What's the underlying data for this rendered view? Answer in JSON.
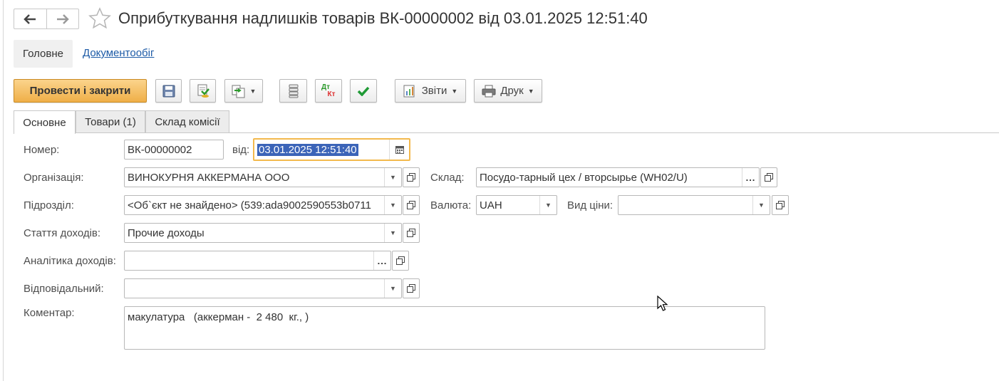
{
  "window": {
    "title": "Оприбуткування надлишків товарів ВК-00000002 від 03.01.2025 12:51:40"
  },
  "sections": {
    "main": "Головне",
    "docflow": "Документообіг"
  },
  "toolbar": {
    "post_and_close": "Провести і закрити",
    "reports": "Звіти",
    "print": "Друк",
    "dtkt_dt": "Дт",
    "dtkt_kt": "Кт"
  },
  "tabs": [
    {
      "label": "Основне",
      "active": true
    },
    {
      "label": "Товари (1)",
      "active": false
    },
    {
      "label": "Склад комісії",
      "active": false
    }
  ],
  "form": {
    "number_label": "Номер:",
    "number_value": "ВК-00000002",
    "date_label": "від:",
    "date_value": "03.01.2025 12:51:40",
    "organization_label": "Організація:",
    "organization_value": "ВИНОКУРНЯ АККЕРМАНА ООО",
    "warehouse_label": "Склад:",
    "warehouse_value": "Посудо-тарный цех / вторсырье (WH02/U)",
    "department_label": "Підрозділ:",
    "department_value": "<Об`єкт не знайдено> (539:ada9002590553b0711",
    "currency_label": "Валюта:",
    "currency_value": "UAH",
    "price_type_label": "Вид ціни:",
    "price_type_value": "",
    "income_item_label": "Стаття доходів:",
    "income_item_value": "Прочие доходы",
    "income_analytics_label": "Аналітика доходів:",
    "income_analytics_value": "",
    "responsible_label": "Відповідальний:",
    "responsible_value": "",
    "comment_label": "Коментар:",
    "comment_value": "макулатура   (аккерман -  2 480  кг., )"
  },
  "colors": {
    "primary_button": "#efaf48",
    "link": "#1c5aa6",
    "focus_border": "#f3b94d",
    "selection": "#3b64b8"
  }
}
